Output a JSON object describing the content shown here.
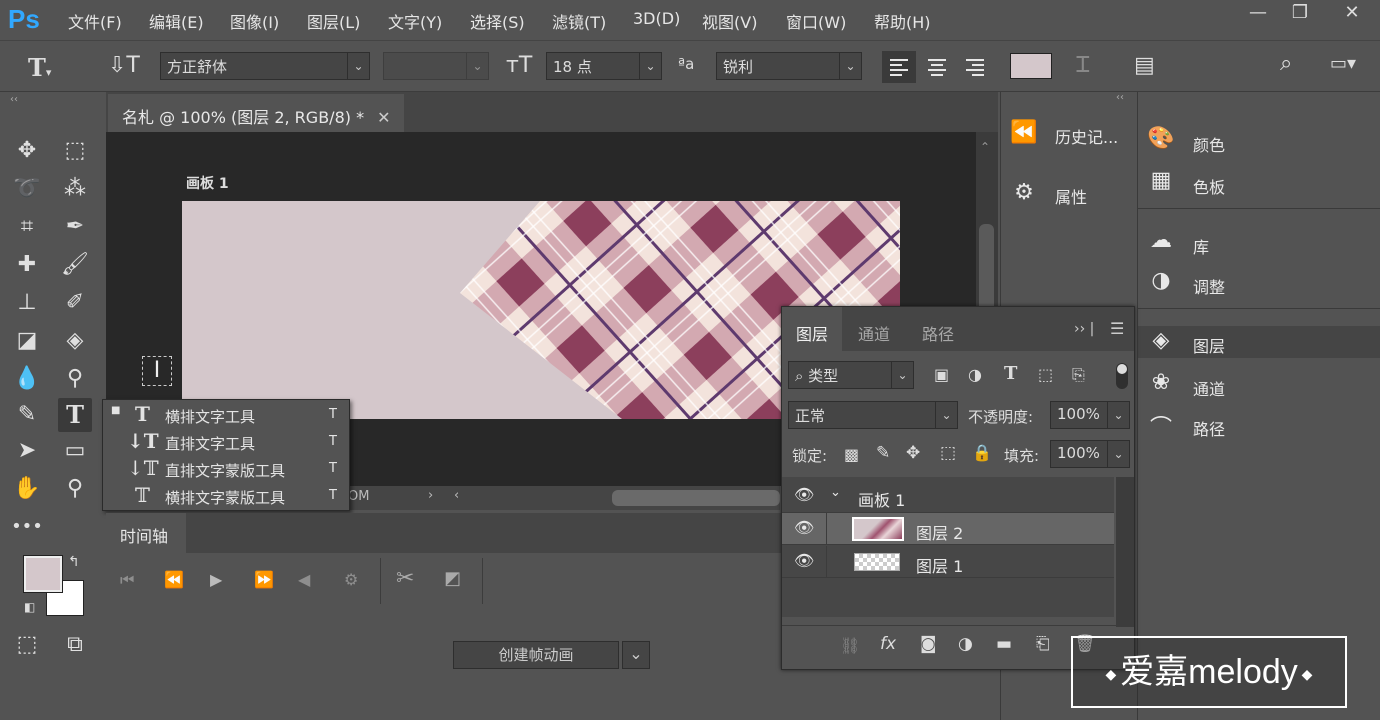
{
  "app": {
    "logo": "Ps"
  },
  "menu": [
    "文件(F)",
    "编辑(E)",
    "图像(I)",
    "图层(L)",
    "文字(Y)",
    "选择(S)",
    "滤镜(T)",
    "3D(D)",
    "视图(V)",
    "窗口(W)",
    "帮助(H)"
  ],
  "options": {
    "font_family": "方正舒体",
    "font_style": "",
    "font_size": "18 点",
    "antialias_label": "ªa",
    "antialias": "锐利",
    "text_color": "#d4c7cb"
  },
  "document": {
    "tab_title": "名札 @ 100% (图层 2, RGB/8) *",
    "artboard_label": "画板 1",
    "zoom_fragment": "OM"
  },
  "flyout": {
    "items": [
      {
        "label": "横排文字工具",
        "shortcut": "T",
        "selected": true
      },
      {
        "label": "直排文字工具",
        "shortcut": "T",
        "selected": false
      },
      {
        "label": "直排文字蒙版工具",
        "shortcut": "T",
        "selected": false
      },
      {
        "label": "横排文字蒙版工具",
        "shortcut": "T",
        "selected": false
      }
    ]
  },
  "timeline": {
    "tab": "时间轴",
    "create_button": "创建帧动画"
  },
  "panels_col1": [
    {
      "label": "历史记...",
      "icon": "history-icon"
    },
    {
      "label": "属性",
      "icon": "properties-icon"
    }
  ],
  "panels_col2": [
    {
      "label": "颜色",
      "icon": "palette-icon"
    },
    {
      "label": "色板",
      "icon": "swatches-icon"
    },
    {
      "label": "库",
      "icon": "cloud-library-icon"
    },
    {
      "label": "调整",
      "icon": "adjust-icon"
    },
    {
      "label": "图层",
      "icon": "layers-icon"
    },
    {
      "label": "通道",
      "icon": "channels-icon"
    },
    {
      "label": "路径",
      "icon": "paths-icon"
    }
  ],
  "layers_panel": {
    "tabs": [
      "图层",
      "通道",
      "路径"
    ],
    "filter": "类型",
    "blend_mode": "正常",
    "opacity_label": "不透明度:",
    "opacity": "100%",
    "lock_label": "锁定:",
    "fill_label": "填充:",
    "fill": "100%",
    "layers": [
      {
        "name": "画板 1",
        "type": "artboard"
      },
      {
        "name": "图层 2",
        "type": "layer",
        "selected": true
      },
      {
        "name": "图层 1",
        "type": "layer",
        "selected": false
      }
    ]
  },
  "colors": {
    "foreground": "#d4c7cb",
    "background": "#ffffff",
    "plaid_dark": "#8c3f5c",
    "plaid_light": "#f3e3dc"
  },
  "watermark": "爱嘉melody"
}
